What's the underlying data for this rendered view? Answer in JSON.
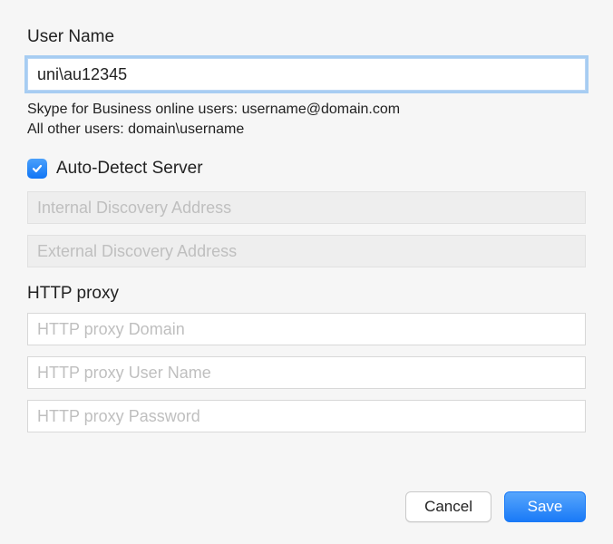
{
  "username": {
    "label": "User Name",
    "value": "uni\\au12345",
    "help_line1": "Skype for Business online users: username@domain.com",
    "help_line2": "All other users: domain\\username"
  },
  "auto_detect": {
    "checked": true,
    "label": "Auto-Detect Server"
  },
  "discovery": {
    "internal_placeholder": "Internal Discovery Address",
    "external_placeholder": "External Discovery Address"
  },
  "proxy": {
    "section_label": "HTTP proxy",
    "domain_placeholder": "HTTP proxy Domain",
    "user_placeholder": "HTTP proxy User Name",
    "password_placeholder": "HTTP proxy Password"
  },
  "buttons": {
    "cancel": "Cancel",
    "save": "Save"
  }
}
